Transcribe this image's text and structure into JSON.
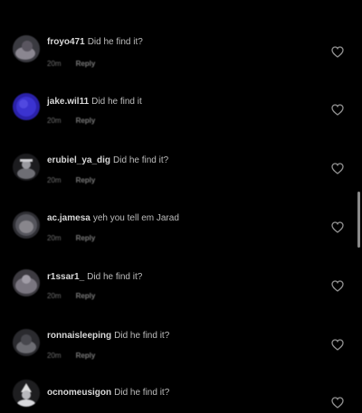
{
  "comments": [
    {
      "username": "froyo471",
      "text": "Did he find it?",
      "time": "20m",
      "reply": "Reply"
    },
    {
      "username": "jake.wil11",
      "text": "Did he find it",
      "time": "20m",
      "reply": "Reply"
    },
    {
      "username": "erubiel_ya_dig",
      "text": "Did he find it?",
      "time": "20m",
      "reply": "Reply"
    },
    {
      "username": "ac.jamesa",
      "text": "yeh you tell em Jarad",
      "time": "20m",
      "reply": "Reply"
    },
    {
      "username": "r1ssar1_",
      "text": "Did he find it?",
      "time": "20m",
      "reply": "Reply"
    },
    {
      "username": "ronnaisleeping",
      "text": "Did he find it?",
      "time": "20m",
      "reply": "Reply"
    },
    {
      "username": "ocnomeusigon",
      "text": "Did he find it?",
      "time": "",
      "reply": ""
    }
  ],
  "colors": {
    "background": "#000000",
    "username": "#d8d8d8",
    "text": "#bdbdbd",
    "meta": "#6f6f6f"
  },
  "icons": {
    "like": "heart-icon",
    "avatar": "avatar"
  }
}
